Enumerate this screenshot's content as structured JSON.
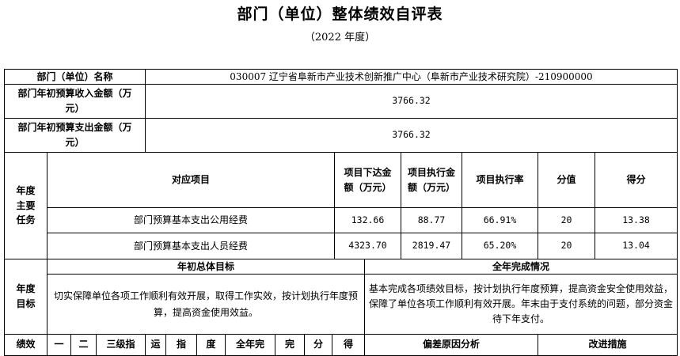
{
  "header": {
    "title": "部门（单位）整体绩效自评表",
    "subtitle": "（2022 年度）"
  },
  "dept": {
    "name_label": "部门（单位）名称",
    "name_value": "030007 辽宁省阜新市产业技术创新推广中心（阜新市产业技术研究院）-210900000",
    "income_label": "部门年初预算收入金额（万元）",
    "income_value": "3766.32",
    "expense_label": "部门年初预算支出金额（万元）",
    "expense_value": "3766.32"
  },
  "tasks": {
    "section_label": "年度主要任务",
    "headers": {
      "project": "对应项目",
      "allocated": "项目下达金额（万元）",
      "executed": "项目执行金额（万元）",
      "rate": "项目执行率",
      "weight": "分值",
      "score": "得分"
    },
    "rows": [
      {
        "project": "部门预算基本支出公用经费",
        "allocated": "132.66",
        "executed": "88.77",
        "rate": "66.91%",
        "weight": "20",
        "score": "13.38"
      },
      {
        "project": "部门预算基本支出人员经费",
        "allocated": "4323.70",
        "executed": "2819.47",
        "rate": "65.20%",
        "weight": "20",
        "score": "13.04"
      }
    ]
  },
  "goals": {
    "section_label": "年度目标",
    "initial_header": "年初总体目标",
    "completion_header": "全年完成情况",
    "initial_text": "切实保障单位各项工作顺利有效开展，取得工作实效，按计划执行年度预算，提高资金使用效益。",
    "completion_text": "基本完成各项绩效目标，按计划执行年度预算，提高资金安全使用效益，保障了单位各项工作顺利有效开展。年末由于支付系统的问题，部分资金待下年支付。"
  },
  "perf": {
    "cells": [
      "绩效",
      "一",
      "二",
      "三级指",
      "运",
      "指",
      "度",
      "全年完",
      "完",
      "分",
      "得",
      "偏差原因分析",
      "改进措施"
    ]
  }
}
